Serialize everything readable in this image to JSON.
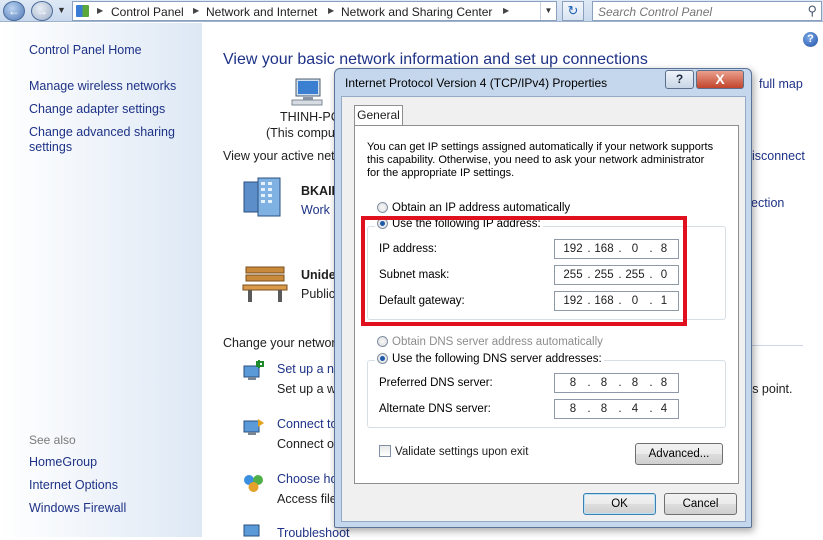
{
  "address_bar": {
    "crumbs": [
      "Control Panel",
      "Network and Internet",
      "Network and Sharing Center"
    ],
    "search_placeholder": "Search Control Panel"
  },
  "left_pane": {
    "links": [
      "Control Panel Home",
      "Manage wireless networks",
      "Change adapter settings",
      "Change advanced sharing settings"
    ],
    "see_also_label": "See also",
    "see_also": [
      "HomeGroup",
      "Internet Options",
      "Windows Firewall"
    ]
  },
  "main": {
    "title": "View your basic network information and set up connections",
    "full_map": "full map",
    "computer_name": "THINH-PC",
    "computer_sub": "(This comput",
    "active_networks": "View your active netw",
    "disconnect": "isconnect",
    "network1_name": "BKAII-",
    "network1_type": "Work n",
    "connection": "ection",
    "network2_name": "Unide",
    "network2_type": "Public",
    "change_settings": "Change your network",
    "tasks": [
      {
        "link": "Set up a ne",
        "desc": "Set up a wi"
      },
      {
        "link": "Connect to",
        "desc": "Connect or"
      },
      {
        "link": "Choose hor",
        "desc": "Access files"
      },
      {
        "link": "Troubleshoot",
        "desc": ""
      }
    ],
    "access_point": "ess point."
  },
  "dialog": {
    "title": "Internet Protocol Version 4 (TCP/IPv4) Properties",
    "help": "?",
    "close": "X",
    "tab": "General",
    "intro": "You can get IP settings assigned automatically if your network supports this capability. Otherwise, you need to ask your network administrator for the appropriate IP settings.",
    "ip_auto": "Obtain an IP address automatically",
    "ip_manual": "Use the following IP address:",
    "ip_label": "IP address:",
    "ip_value": [
      "192",
      "168",
      "0",
      "8"
    ],
    "mask_label": "Subnet mask:",
    "mask_value": [
      "255",
      "255",
      "255",
      "0"
    ],
    "gw_label": "Default gateway:",
    "gw_value": [
      "192",
      "168",
      "0",
      "1"
    ],
    "dns_auto": "Obtain DNS server address automatically",
    "dns_manual": "Use the following DNS server addresses:",
    "dns1_label": "Preferred DNS server:",
    "dns1_value": [
      "8",
      "8",
      "8",
      "8"
    ],
    "dns2_label": "Alternate DNS server:",
    "dns2_value": [
      "8",
      "8",
      "4",
      "4"
    ],
    "validate": "Validate settings upon exit",
    "advanced": "Advanced...",
    "ok": "OK",
    "cancel": "Cancel"
  },
  "highlight_color": "#e0101e"
}
